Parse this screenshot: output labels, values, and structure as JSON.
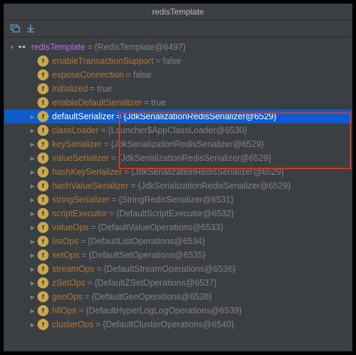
{
  "title": "redisTemplate",
  "root": {
    "name": "redisTemplate",
    "value": "{RedisTemplate@6497}"
  },
  "items": [
    {
      "name": "enableTransactionSupport",
      "value": "false",
      "lit": true
    },
    {
      "name": "exposeConnection",
      "value": "false",
      "lit": true
    },
    {
      "name": "initialized",
      "value": "true",
      "lit": true
    },
    {
      "name": "enableDefaultSerializer",
      "value": "true",
      "lit": true
    },
    {
      "name": "defaultSerializer",
      "value": "{JdkSerializationRedisSerializer@6529}",
      "selected": true,
      "arrow": true
    },
    {
      "name": "classLoader",
      "value": "{Launcher$AppClassLoader@6530}",
      "arrow": true
    },
    {
      "name": "keySerializer",
      "value": "{JdkSerializationRedisSerializer@6529}",
      "arrow": true
    },
    {
      "name": "valueSerializer",
      "value": "{JdkSerializationRedisSerializer@6529}",
      "arrow": true
    },
    {
      "name": "hashKeySerializer",
      "value": "{JdkSerializationRedisSerializer@6529}",
      "arrow": true
    },
    {
      "name": "hashValueSerializer",
      "value": "{JdkSerializationRedisSerializer@6529}",
      "arrow": true
    },
    {
      "name": "stringSerializer",
      "value": "{StringRedisSerializer@6531}",
      "arrow": true
    },
    {
      "name": "scriptExecutor",
      "value": "{DefaultScriptExecutor@6532}",
      "arrow": true
    },
    {
      "name": "valueOps",
      "value": "{DefaultValueOperations@6533}",
      "arrow": true
    },
    {
      "name": "listOps",
      "value": "{DefaultListOperations@6534}",
      "arrow": true
    },
    {
      "name": "setOps",
      "value": "{DefaultSetOperations@6535}",
      "arrow": true
    },
    {
      "name": "streamOps",
      "value": "{DefaultStreamOperations@6536}",
      "arrow": true
    },
    {
      "name": "zSetOps",
      "value": "{DefaultZSetOperations@6537}",
      "arrow": true
    },
    {
      "name": "geoOps",
      "value": "{DefaultGeoOperations@6538}",
      "arrow": true
    },
    {
      "name": "hllOps",
      "value": "{DefaultHyperLogLogOperations@6539}",
      "arrow": true
    },
    {
      "name": "clusterOps",
      "value": "{DefaultClusterOperations@6540}",
      "arrow": true
    }
  ]
}
